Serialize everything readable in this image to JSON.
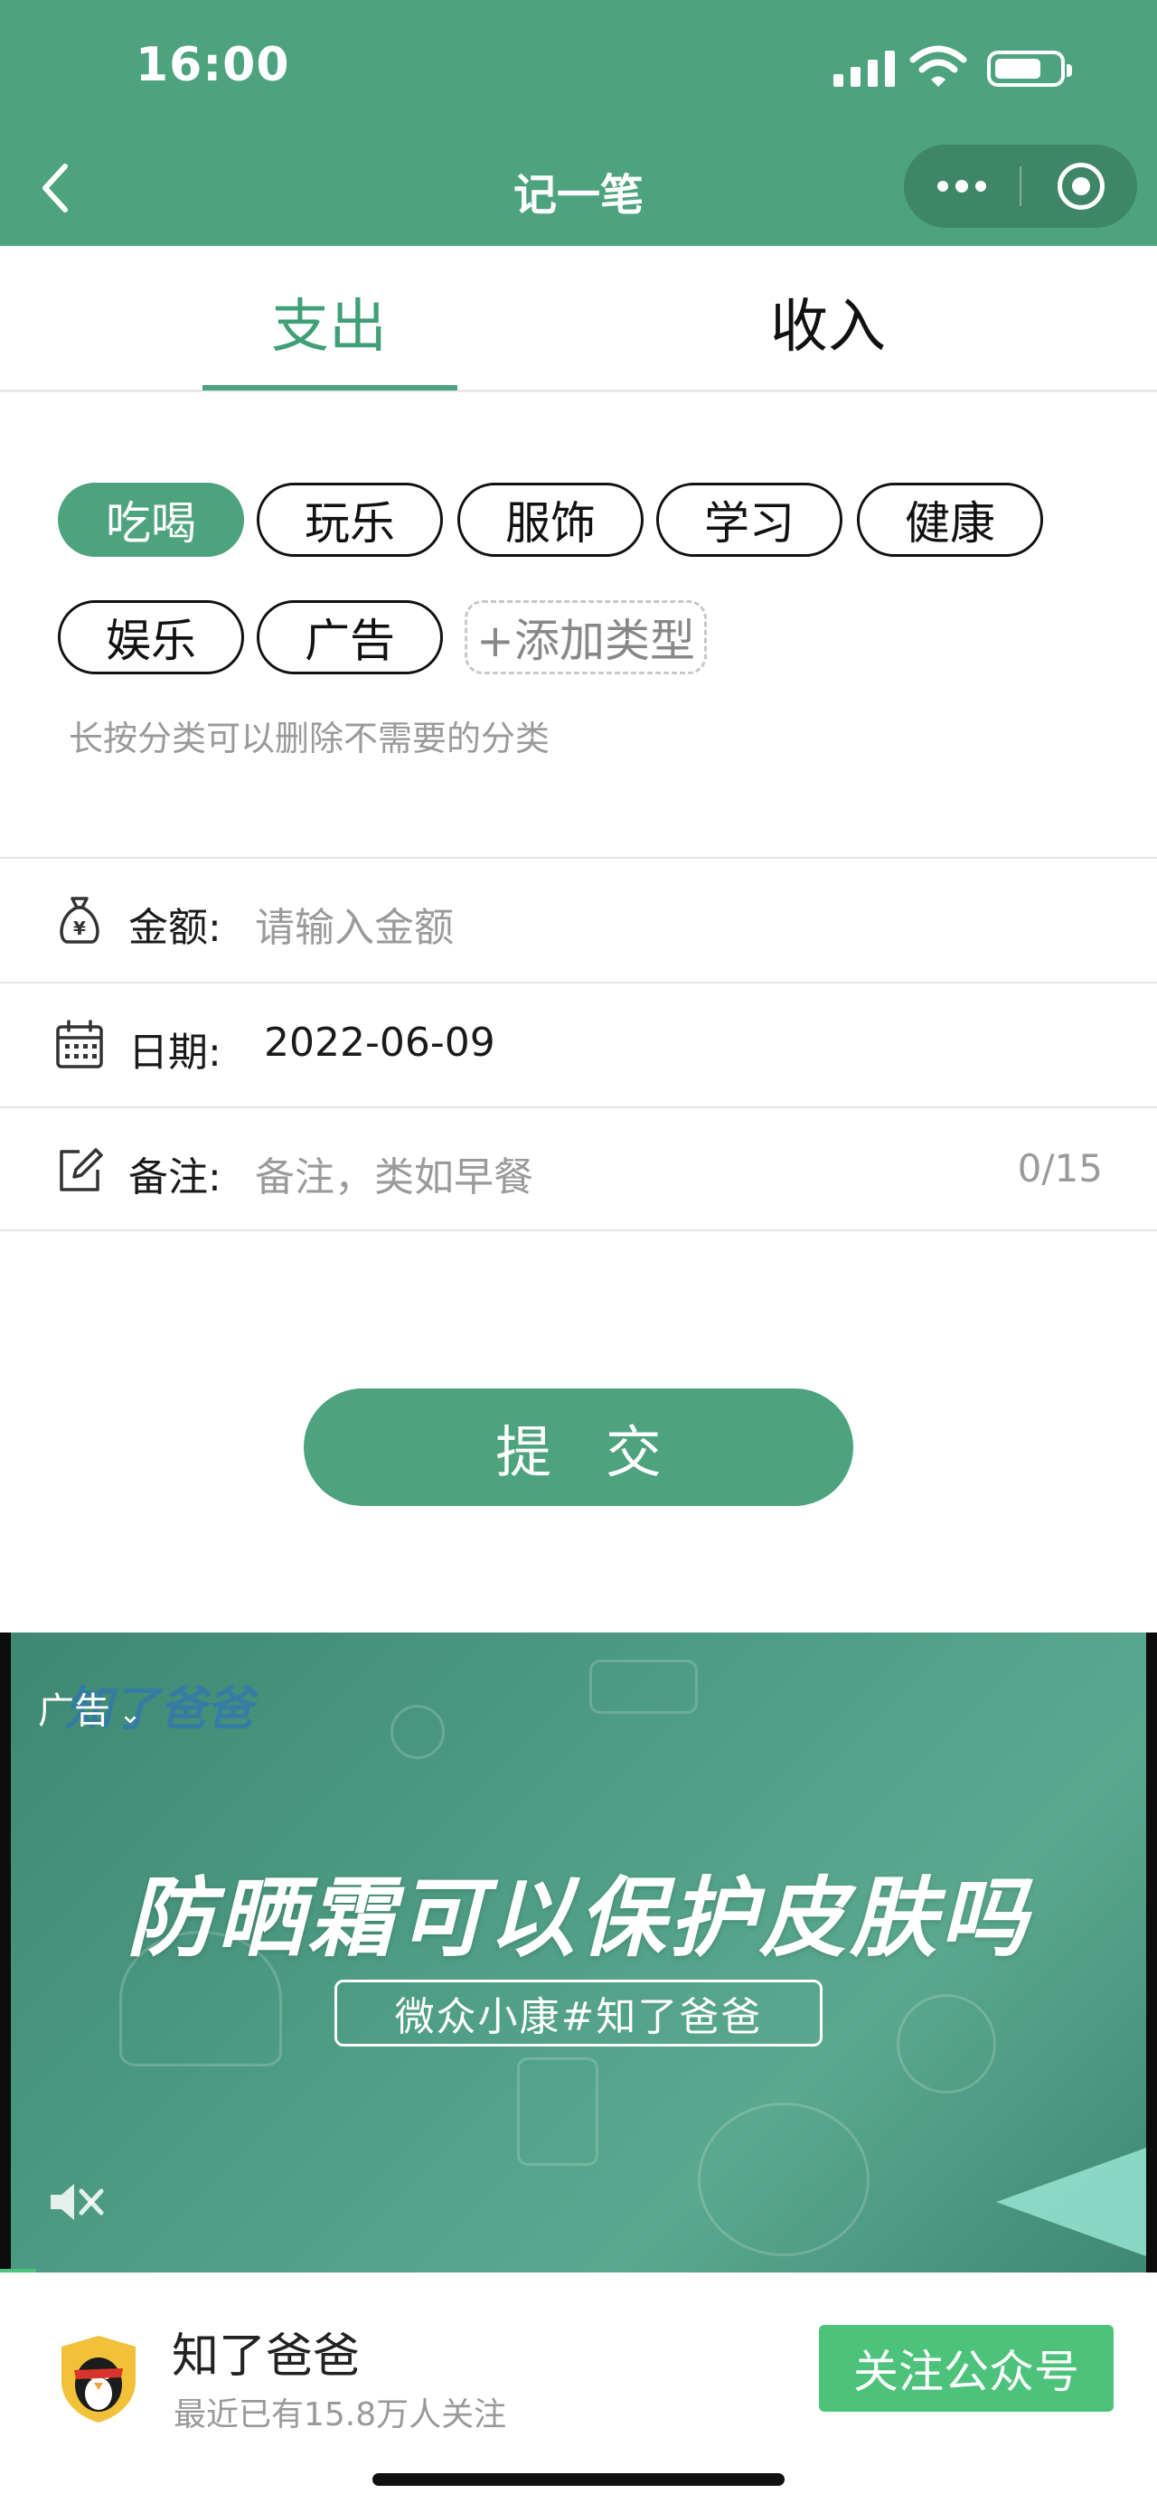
{
  "status_bar": {
    "time": "16:00"
  },
  "nav": {
    "title": "记一笔"
  },
  "tabs": [
    {
      "label": "支出",
      "active": true
    },
    {
      "label": "收入",
      "active": false
    }
  ],
  "categories": [
    {
      "label": "吃喝",
      "active": true
    },
    {
      "label": "玩乐",
      "active": false
    },
    {
      "label": "服饰",
      "active": false
    },
    {
      "label": "学习",
      "active": false
    },
    {
      "label": "健康",
      "active": false
    },
    {
      "label": "娱乐",
      "active": false
    },
    {
      "label": "广告",
      "active": false
    }
  ],
  "add_category_label": "+添加类型",
  "hint": "长按分类可以删除不需要的分类",
  "form": {
    "amount": {
      "label": "金额:",
      "placeholder": "请输入金额",
      "icon": "money-bag-icon"
    },
    "date": {
      "label": "日期:",
      "value": "2022-06-09",
      "icon": "calendar-icon"
    },
    "note": {
      "label": "备注:",
      "placeholder": "备注，类如早餐",
      "counter": "0/15",
      "icon": "edit-icon"
    }
  },
  "submit_label": "提 交",
  "ad": {
    "label": "广告",
    "logo_text": "知了爸爸",
    "headline": "防晒霜可以保护皮肤吗",
    "subtitle": "微众小康#知了爸爸",
    "account_name": "知了爸爸",
    "account_desc": "最近已有15.8万人关注",
    "follow_label": "关注公众号"
  },
  "colors": {
    "brand": "#4da37e",
    "follow": "#4cc27a"
  }
}
